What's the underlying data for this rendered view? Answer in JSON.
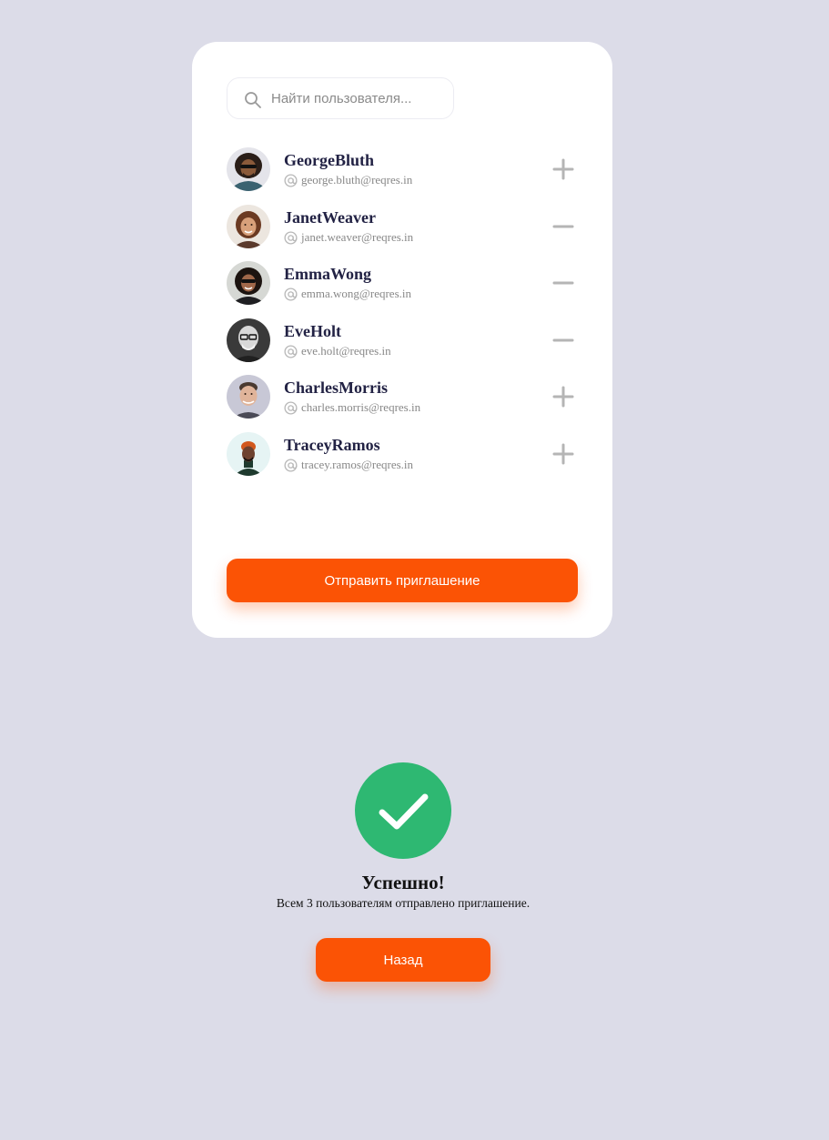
{
  "search": {
    "placeholder": "Найти пользователя...",
    "value": ""
  },
  "users": [
    {
      "name": "GeorgeBluth",
      "email": "george.bluth@reqres.in",
      "action": "plus",
      "avatar_icon": "avatar-george-bluth"
    },
    {
      "name": "JanetWeaver",
      "email": "janet.weaver@reqres.in",
      "action": "minus",
      "avatar_icon": "avatar-janet-weaver"
    },
    {
      "name": "EmmaWong",
      "email": "emma.wong@reqres.in",
      "action": "minus",
      "avatar_icon": "avatar-emma-wong"
    },
    {
      "name": "EveHolt",
      "email": "eve.holt@reqres.in",
      "action": "minus",
      "avatar_icon": "avatar-eve-holt"
    },
    {
      "name": "CharlesMorris",
      "email": "charles.morris@reqres.in",
      "action": "plus",
      "avatar_icon": "avatar-charles-morris"
    },
    {
      "name": "TraceyRamos",
      "email": "tracey.ramos@reqres.in",
      "action": "plus",
      "avatar_icon": "avatar-tracey-ramos"
    }
  ],
  "send_button": {
    "label": "Отправить приглашение"
  },
  "success": {
    "title": "Успешно!",
    "message": "Всем 3 пользователям отправлено приглашение.",
    "back_label": "Назад",
    "icon": "checkmark-icon"
  },
  "colors": {
    "background": "#dcdce8",
    "card": "#ffffff",
    "accent": "#fb5305",
    "success": "#2eb872",
    "name_text": "#222244",
    "muted": "#888888",
    "icon_gray": "#b5b5b5"
  }
}
